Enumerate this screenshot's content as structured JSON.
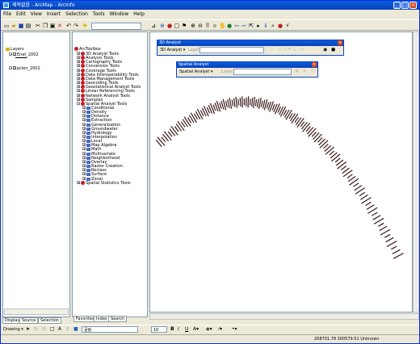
{
  "window": {
    "title": "제목없음 - ArcMap - ArcInfo",
    "minimize": "_",
    "maximize": "□",
    "close": "×"
  },
  "menu": [
    "File",
    "Edit",
    "View",
    "Insert",
    "Selection",
    "Tools",
    "Window",
    "Help"
  ],
  "toolbar": {
    "scale_value": "",
    "icons": [
      "new-icon",
      "open-icon",
      "save-icon",
      "print-icon",
      "cut-icon",
      "copy-icon",
      "paste-icon",
      "delete-icon",
      "undo-icon",
      "redo-icon",
      "add-data-icon",
      "zoom-in-icon",
      "zoom-out-icon",
      "fixed-zoom-in-icon",
      "fixed-zoom-out-icon",
      "pan-icon",
      "full-extent-icon",
      "back-icon",
      "forward-icon",
      "select-icon",
      "identify-icon",
      "find-icon",
      "measure-icon",
      "hyperlink-icon"
    ]
  },
  "toc": {
    "root": "Layers",
    "layers": [
      {
        "name": "Enet_2002",
        "checked": true
      },
      {
        "name": "pclen_2002",
        "checked": true
      }
    ],
    "tabs": [
      "Display",
      "Source",
      "Selection"
    ]
  },
  "toolbox": {
    "root": "ArcToolbox",
    "items": [
      {
        "label": "3D Analyst Tools",
        "level": 1,
        "type": "toolbox"
      },
      {
        "label": "Analysis Tools",
        "level": 1,
        "type": "toolbox"
      },
      {
        "label": "Cartography Tools",
        "level": 1,
        "type": "toolbox"
      },
      {
        "label": "Conversion Tools",
        "level": 1,
        "type": "toolbox"
      },
      {
        "label": "Coverage Tools",
        "level": 1,
        "type": "toolbox"
      },
      {
        "label": "Data Interoperability Tools",
        "level": 1,
        "type": "toolbox"
      },
      {
        "label": "Data Management Tools",
        "level": 1,
        "type": "toolbox"
      },
      {
        "label": "Geocoding Tools",
        "level": 1,
        "type": "toolbox"
      },
      {
        "label": "Geostatistical Analyst Tools",
        "level": 1,
        "type": "toolbox"
      },
      {
        "label": "Linear Referencing Tools",
        "level": 1,
        "type": "toolbox"
      },
      {
        "label": "Network Analyst Tools",
        "level": 1,
        "type": "toolbox"
      },
      {
        "label": "Samples",
        "level": 1,
        "type": "toolbox"
      },
      {
        "label": "Spatial Analyst Tools",
        "level": 1,
        "type": "toolbox"
      },
      {
        "label": "Conditional",
        "level": 2,
        "type": "toolset"
      },
      {
        "label": "Density",
        "level": 2,
        "type": "toolset"
      },
      {
        "label": "Distance",
        "level": 2,
        "type": "toolset"
      },
      {
        "label": "Extraction",
        "level": 2,
        "type": "toolset"
      },
      {
        "label": "Generalization",
        "level": 2,
        "type": "toolset"
      },
      {
        "label": "Groundwater",
        "level": 2,
        "type": "toolset"
      },
      {
        "label": "Hydrology",
        "level": 2,
        "type": "toolset"
      },
      {
        "label": "Interpolation",
        "level": 2,
        "type": "toolset"
      },
      {
        "label": "Local",
        "level": 2,
        "type": "toolset"
      },
      {
        "label": "Map Algebra",
        "level": 2,
        "type": "toolset"
      },
      {
        "label": "Math",
        "level": 2,
        "type": "toolset"
      },
      {
        "label": "Multivariate",
        "level": 2,
        "type": "toolset"
      },
      {
        "label": "Neighborhood",
        "level": 2,
        "type": "toolset"
      },
      {
        "label": "Overlay",
        "level": 2,
        "type": "toolset"
      },
      {
        "label": "Raster Creation",
        "level": 2,
        "type": "toolset"
      },
      {
        "label": "Reclass",
        "level": 2,
        "type": "toolset"
      },
      {
        "label": "Surface",
        "level": 2,
        "type": "toolset"
      },
      {
        "label": "Zonal",
        "level": 2,
        "type": "toolset"
      },
      {
        "label": "Spatial Statistics Tools",
        "level": 1,
        "type": "toolbox"
      }
    ],
    "tabs": [
      "Favorites",
      "Index",
      "Search"
    ]
  },
  "analyst3d": {
    "title": "3D Analyst",
    "dropdown": "3D Analyst ▾",
    "layer_label": "Layer:"
  },
  "spatial": {
    "title": "Spatial Analyst",
    "dropdown": "Spatial Analyst ▾",
    "layer_label": "Layer:"
  },
  "drawing": {
    "label": "Drawing ▾",
    "font": "굴림",
    "font_size": "10",
    "bold": "B",
    "italic": "I",
    "underline": "U"
  },
  "status": {
    "coords": "208701.78  300579.51 Unknown"
  }
}
